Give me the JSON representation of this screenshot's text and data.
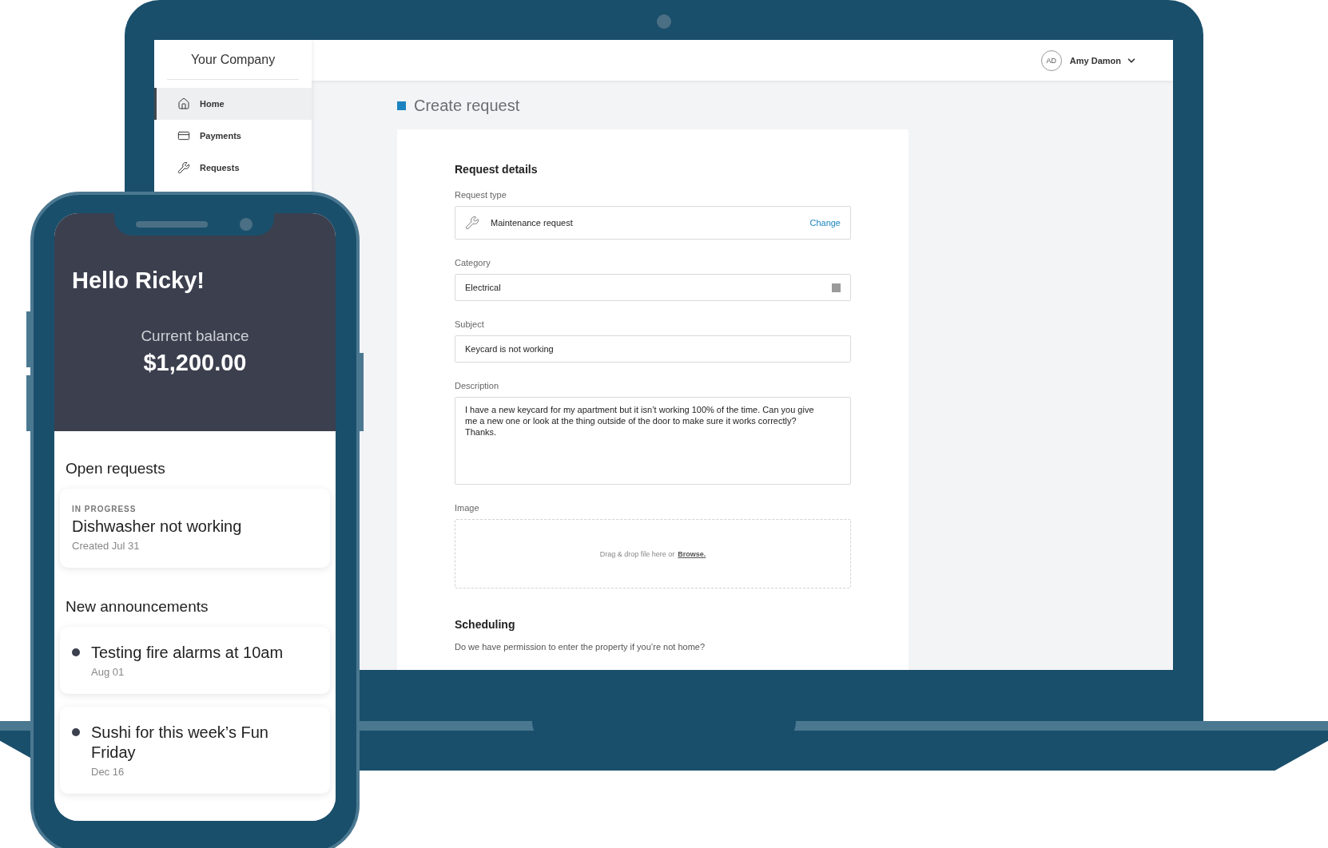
{
  "laptop": {
    "sidebar": {
      "company": "Your Company",
      "items": [
        {
          "label": "Home",
          "selected": true
        },
        {
          "label": "Payments",
          "selected": false
        },
        {
          "label": "Requests",
          "selected": false
        }
      ]
    },
    "header": {
      "initials": "AD",
      "user": "Amy Damon"
    },
    "page_title": "Create request",
    "form": {
      "section": "Request details",
      "fields": [
        {
          "kind": "type",
          "label": "Request type",
          "value": "Maintenance request",
          "action": "Change"
        },
        {
          "kind": "select",
          "label": "Category",
          "value": "Electrical"
        },
        {
          "kind": "text",
          "label": "Subject",
          "value": "Keycard is not working"
        },
        {
          "kind": "textarea",
          "label": "Description",
          "value": "I have a new keycard for my apartment but it isn’t working 100% of the time. Can you give me a new one or look at the thing outside of the door to make sure it works correctly? Thanks."
        },
        {
          "kind": "dropzone",
          "label": "Image",
          "prompt": "Drag & drop file here or",
          "action": "Browse."
        }
      ],
      "section_2": "Scheduling",
      "question": "Do we have permission to enter the property if you’re not home?"
    }
  },
  "phone": {
    "greeting": "Hello Ricky!",
    "balance_label": "Current balance",
    "balance": "$1,200.00",
    "open_requests_title": "Open requests",
    "requests": [
      {
        "status": "IN PROGRESS",
        "title": "Dishwasher not working",
        "created": "Created Jul 31"
      }
    ],
    "announcements_title": "New announcements",
    "announcements": [
      {
        "title": "Testing fire alarms at 10am",
        "date": "Aug 01"
      },
      {
        "title": "Sushi for this week’s Fun Friday",
        "date": "Dec 16"
      }
    ]
  }
}
